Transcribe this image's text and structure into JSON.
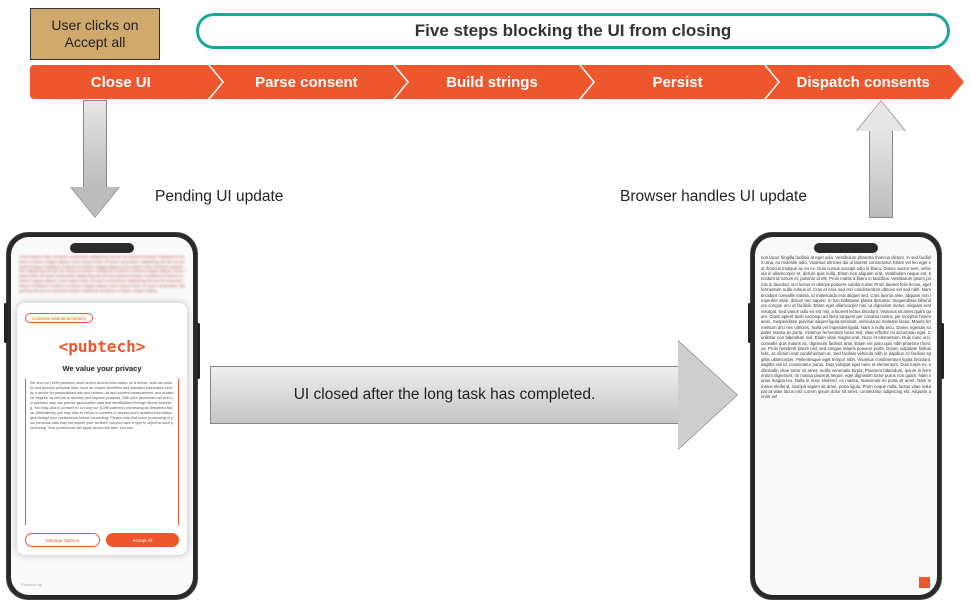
{
  "user_click_box": "User clicks on Accept all",
  "five_steps_label": "Five steps blocking the UI from closing",
  "steps": [
    "Close UI",
    "Parse consent",
    "Build strings",
    "Persist",
    "Dispatch consents"
  ],
  "label_pending": "Pending UI update",
  "label_browser": "Browser handles UI update",
  "big_arrow_text": "UI closed after the long task has completed.",
  "phone_a": {
    "logo": "<pubtech>",
    "continue_without": "Continue without accepting",
    "heading": "We value your privacy",
    "body_text": "We and our (1399 partners) store and/or access information on a device, such as cookies and process personal data, such as unique identifiers and standard information sent by a device for personalised ads and content, ad and content measurement, and audience insights, as well as to develop and improve products. With your permission we and our partners may use precise geolocation data and identification through device scanning. You may click to consent to our and our (1399 partners) processing as described above. Alternatively you may click to refuse to consent or access more detailed information and change your preferences before consenting. Please note that some processing of your personal data may not require your consent, but you have a right to object to such processing. Your preferences will apply across the web. You can",
    "manage_label": "Manage Options",
    "accept_label": "Accept All",
    "footer": "Powered by"
  },
  "phone_b_text": "non lacus fringilla facilisis at eget odio. Vestibulum pharetra rhoncus dictum. In sed facilisis urna, eu molestie odio. Vivamus ultricies dui ut laoreet consectetur. Etiam vel leo eget est rhoncus tristique ac eu ex. Duis cursus suscipit odio in libero. Donec auctor sem, vehicula in ullamcorper et, dictum quis nulla. Etiam non aliquam erat. Vestibulum neque est, tincidunt id rutrum et, pulvinar id elit. Proin mattis a libero in faucibus. Vestibulum ipsum primis in faucibus orci luctus et ultrices posuere cubilia curae; Proin laoreet felis lectus, eget fermentum nulla cursus id. Cras et eros sed orci condimentum ultrices vel sed nibh. Nam tincidunt convallis massa, id malesuada erat aliquet sed. Cras lacinia ante, aliquam non imperdiet vitae, dictum nec sapien. In hac habitasse platea dictumst. Suspendisse bibendum congue orci et facilisis. Etiam eget ullamcorper nisi, ut dignissim metus. Aliquam erat volutpat. Sed varius odio eu est nisl, a laoreet lectus tincidunt. Vivamus sit amet quam quam. Class aptent taciti sociosqu ad litora torquent per conubia nostra, per inceptos himenaeos. Suspendisse pulvinar aliquet ligula tincidunt, vehicula ac molestie lacus. Mauris fermentum orci nec ultricies. Nulla vel imperdiet ligula. Nam a nulla arcu. Donec egestas sodales massa ac porta. Vivamus fermentum lacus nisl, vitae efficitur mi accumsan eget. Curabitur non bibendum nisl. Etiam vitae magna erat. Nunc et elementum. Duis nunc orci, convallis quis mauris ac, dignissim facilisis ante. Etiam vel justo quis nibh pharetra rhoncus. Proin hendrerit ipsum nisl, sed congue mauris posuere porta. Donec vulputate finibus felis, ac dictum erat condimentum at. Sed facilisis vehicula nibh in dapibus. In facilisis sagittis ullamcorper. Pellentesque eget tempor nibh. Vivamus condimentum ligula tincidunt, sagittis nisi id, consectetur purus. Duis volutpat eget nunc et elementum. Duis turpis ex, sollicitudin vitae tortor sit amet, mollis venenatis turpis. Praesent bibendum, ipsum in fermentum dignissim, mi massa placerat neque, eget dignissim tortor purus non quam. Nam varius magna leo. Nulla in nunc eleifend, ex massa, maecenas mi porta sit amet. Nam in metus eleifend, suscipit sapien sit amet, porta ligula. Proin neque nulla, luctus vitae volutpat at vitae lacus nisl. Lorem ipsum dolor sit amet, consectetur adipiscing elit. Aliquam a enim vel"
}
